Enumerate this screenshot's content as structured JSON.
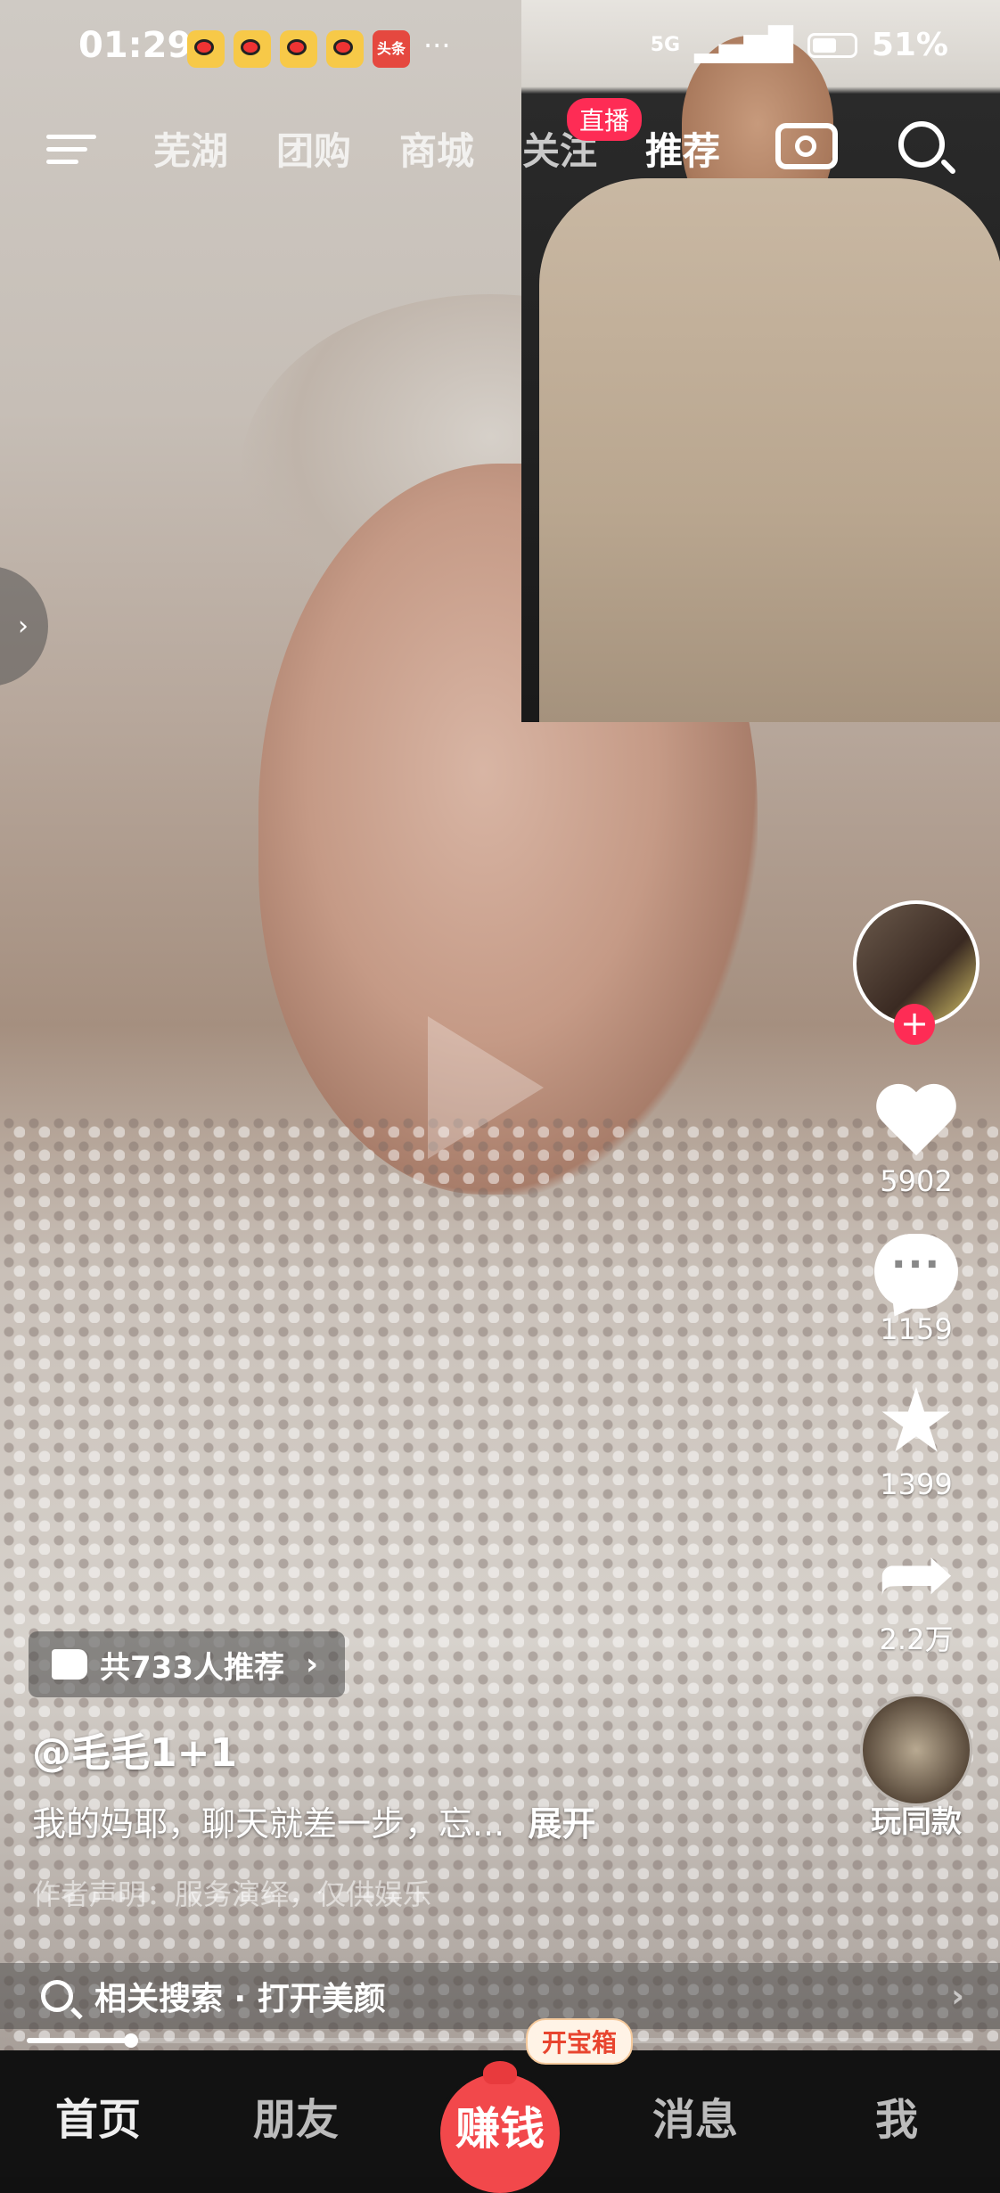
{
  "status_bar": {
    "time": "01:29",
    "app_icons": [
      "weibo-icon",
      "weibo-icon",
      "weibo-icon",
      "weibo-icon"
    ],
    "toutiao_label": "头条",
    "more": "···",
    "network": "5G",
    "battery_percent": "51%"
  },
  "top_nav": {
    "tabs": [
      "芜湖",
      "团购",
      "商城",
      "关注",
      "推荐"
    ],
    "live_badge": "直播"
  },
  "side_tab_arrow": "›",
  "actions": {
    "likes": "5902",
    "comments": "1159",
    "favorites": "1399",
    "shares": "2.2万",
    "music_label": "玩同款"
  },
  "video_info": {
    "recommend_text": "共733人推荐",
    "recommend_chevron": "›",
    "author": "@毛毛1+1",
    "caption": "我的妈耶，聊天就差一步，忘...",
    "expand": "展开",
    "hint": "作者声明：服务演绎，仅供娱乐"
  },
  "related_search": {
    "text": "相关搜索 · 打开美颜",
    "arrow": "›"
  },
  "progress": 0.11,
  "bottom_nav": {
    "home": "首页",
    "friends": "朋友",
    "earn": "赚钱",
    "treasure_badge": "开宝箱",
    "messages": "消息",
    "me": "我"
  }
}
